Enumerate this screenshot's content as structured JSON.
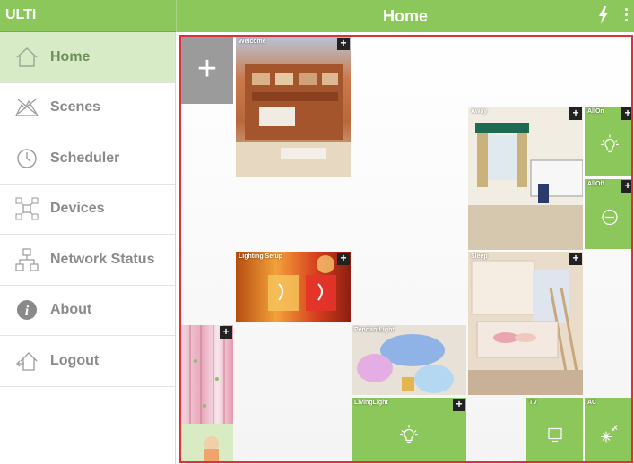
{
  "app": {
    "name": "ULTI"
  },
  "header": {
    "title": "Home"
  },
  "sidebar": {
    "items": [
      {
        "label": "Home",
        "icon": "home-icon",
        "active": true
      },
      {
        "label": "Scenes",
        "icon": "scenes-icon"
      },
      {
        "label": "Scheduler",
        "icon": "clock-icon"
      },
      {
        "label": "Devices",
        "icon": "devices-icon"
      },
      {
        "label": "Network Status",
        "icon": "network-icon"
      },
      {
        "label": "About",
        "icon": "info-icon"
      },
      {
        "label": "Logout",
        "icon": "logout-icon"
      }
    ]
  },
  "tiles": {
    "add": {
      "symbol": "+"
    },
    "welcome": {
      "label": "Welcome"
    },
    "away": {
      "label": "Away"
    },
    "allon": {
      "label": "AllOn"
    },
    "alloff": {
      "label": "AllOff"
    },
    "lighting": {
      "label": "Lighting Setup"
    },
    "sleep": {
      "label": "Sleep"
    },
    "pendant": {
      "label": "PendantLight"
    },
    "living": {
      "label": "LivingLight"
    },
    "tv": {
      "label": "TV"
    },
    "ac": {
      "label": "AC"
    },
    "plus_symbol": "+"
  },
  "colors": {
    "accent": "#8cc75c",
    "active_bg": "#d7ebc6",
    "frame": "#e0303a"
  }
}
